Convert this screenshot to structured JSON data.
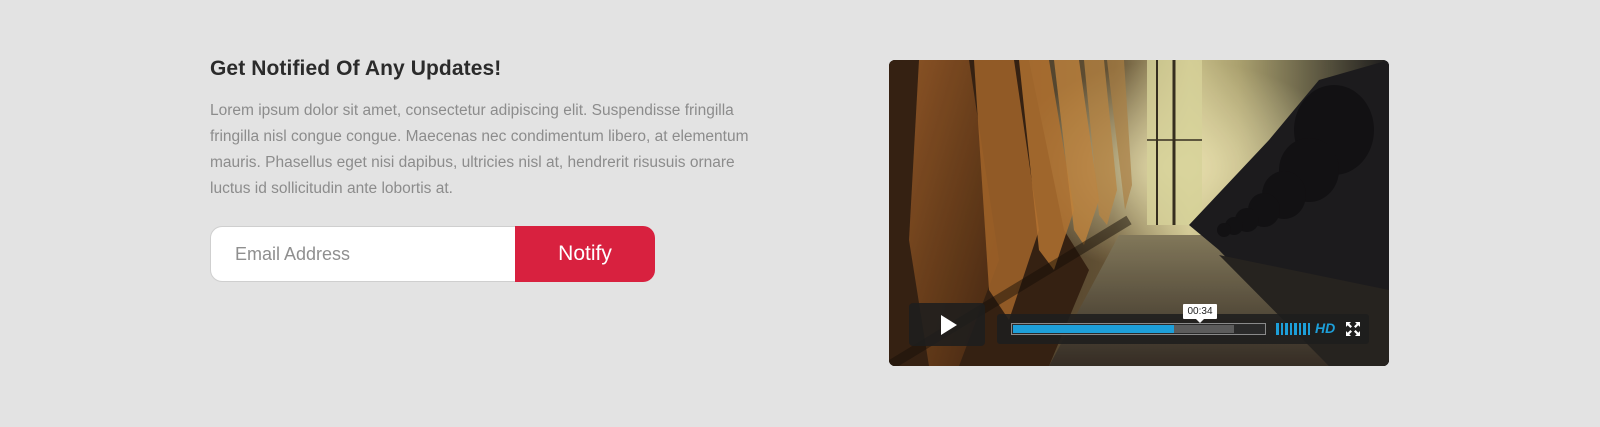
{
  "signup": {
    "title": "Get Notified Of Any Updates!",
    "description": "Lorem ipsum dolor sit amet, consectetur adipiscing elit. Suspendisse fringilla fringilla nisl congue congue. Maecenas nec condimentum libero, at elementum mauris. Phasellus eget nisi dapibus, ultricies nisl at, hendrerit risusuis ornare luctus id sollicitudin ante lobortis at.",
    "email_placeholder": "Email Address",
    "notify_label": "Notify"
  },
  "video_player": {
    "current_time": "00:34",
    "progress_played": 0.64,
    "progress_buffered": 0.88,
    "volume_bars": 8,
    "quality_label": "HD",
    "icons": {
      "play": "play-icon",
      "fullscreen": "fullscreen-icon"
    }
  },
  "colors": {
    "background": "#e3e3e3",
    "accent_button": "#d8213f",
    "player_accent": "#1d9fd9"
  }
}
